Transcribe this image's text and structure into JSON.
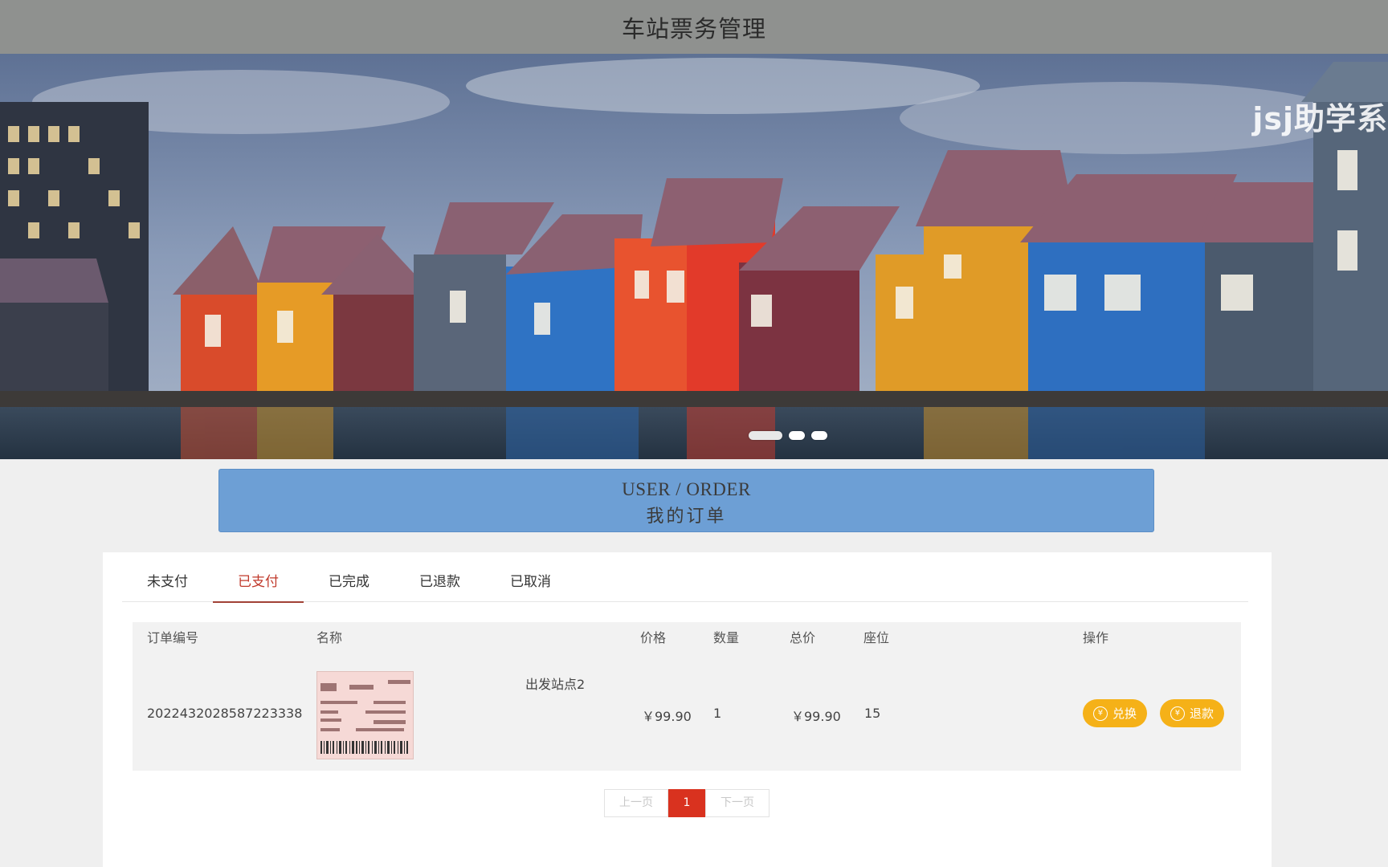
{
  "header": {
    "title": "车站票务管理"
  },
  "banner": {
    "watermark": "jsj助学系",
    "slide_count": 3,
    "active_slide": 1
  },
  "section": {
    "title_en": "USER / ORDER",
    "title_cn": "我的订单"
  },
  "tabs": [
    {
      "label": "未支付",
      "active": false
    },
    {
      "label": "已支付",
      "active": true
    },
    {
      "label": "已完成",
      "active": false
    },
    {
      "label": "已退款",
      "active": false
    },
    {
      "label": "已取消",
      "active": false
    }
  ],
  "table": {
    "headers": {
      "order_no": "订单编号",
      "name": "名称",
      "price": "价格",
      "qty": "数量",
      "total": "总价",
      "seat": "座位",
      "action": "操作"
    },
    "rows": [
      {
        "order_no": "2022432028587223338",
        "name": "出发站点2",
        "price": "￥99.90",
        "qty": "1",
        "total": "￥99.90",
        "seat": "15",
        "actions": {
          "exchange": "兑换",
          "refund": "退款"
        }
      }
    ]
  },
  "pager": {
    "prev": "上一页",
    "current": "1",
    "next": "下一页"
  },
  "colors": {
    "header_bg": "#8f918f",
    "section_bg": "#6d9fd5",
    "active_tab": "#a14136",
    "button": "#f5b118",
    "page_current": "#d9321f"
  }
}
